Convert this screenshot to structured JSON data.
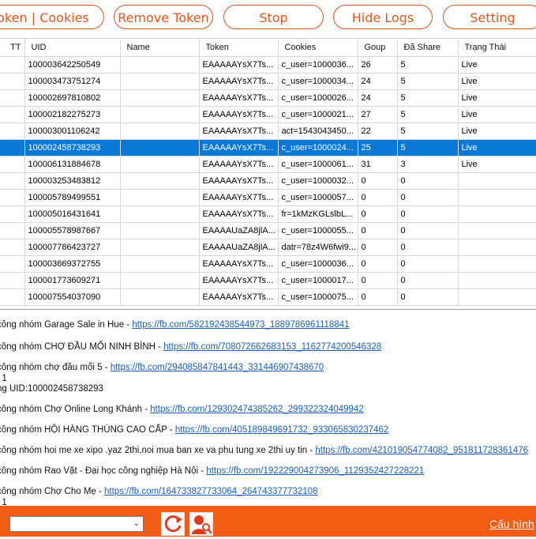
{
  "toolbar": {
    "token_cookies_label": "Token | Cookies",
    "remove_token_label": "Remove Token",
    "stop_label": "Stop",
    "hide_logs_label": "Hide Logs",
    "setting_label": "Setting"
  },
  "grid": {
    "columns": [
      "TT",
      "UID",
      "Name",
      "Token",
      "Cookies",
      "Goup",
      "Đã Share",
      "Trạng Thái"
    ],
    "selected_row": 5,
    "rows": [
      {
        "uid": "100003642250549",
        "name": "",
        "token": "EAAAAAYsX7Ts...",
        "cookies": "c_user=1000036...",
        "goup": "26",
        "shared": "5",
        "status": "Live"
      },
      {
        "uid": "100003473751274",
        "name": "",
        "token": "EAAAAAYsX7Ts...",
        "cookies": "c_user=1000034...",
        "goup": "24",
        "shared": "5",
        "status": "Live"
      },
      {
        "uid": "100002697810802",
        "name": "",
        "token": "EAAAAAYsX7Ts...",
        "cookies": "c_user=1000026...",
        "goup": "24",
        "shared": "5",
        "status": "Live"
      },
      {
        "uid": "100002182275273",
        "name": "",
        "token": "EAAAAAYsX7Ts...",
        "cookies": "c_user=1000021...",
        "goup": "27",
        "shared": "5",
        "status": "Live"
      },
      {
        "uid": "100003001106242",
        "name": "",
        "token": "EAAAAAYsX7Ts...",
        "cookies": "act=1543043450...",
        "goup": "22",
        "shared": "5",
        "status": "Live"
      },
      {
        "uid": "100002458738293",
        "name": "",
        "token": "EAAAAAYsX7Ts...",
        "cookies": "c_user=1000024...",
        "goup": "25",
        "shared": "5",
        "status": "Live"
      },
      {
        "uid": "100006131884678",
        "name": "",
        "token": "EAAAAAYsX7Ts...",
        "cookies": "c_user=1000061...",
        "goup": "31",
        "shared": "3",
        "status": "Live"
      },
      {
        "uid": "100003253483812",
        "name": "",
        "token": "EAAAAAYsX7Ts...",
        "cookies": "c_user=1000032...",
        "goup": "0",
        "shared": "0",
        "status": ""
      },
      {
        "uid": "100005789499551",
        "name": "",
        "token": "EAAAAAYsX7Ts...",
        "cookies": "c_user=1000057...",
        "goup": "0",
        "shared": "0",
        "status": ""
      },
      {
        "uid": "100005016431641",
        "name": "",
        "token": "EAAAAAYsX7Ts...",
        "cookies": "fr=1kMzKGLslbL...",
        "goup": "0",
        "shared": "0",
        "status": ""
      },
      {
        "uid": "100005578987667",
        "name": "",
        "token": "EAAAAUaZA8jlA...",
        "cookies": "c_user=1000055...",
        "goup": "0",
        "shared": "0",
        "status": ""
      },
      {
        "uid": "100007786423727",
        "name": "",
        "token": "EAAAAUaZA8jlA...",
        "cookies": "datr=78z4W6fwi9...",
        "goup": "0",
        "shared": "0",
        "status": ""
      },
      {
        "uid": "100003669372755",
        "name": "",
        "token": "EAAAAAYsX7Ts...",
        "cookies": "c_user=1000036...",
        "goup": "0",
        "shared": "0",
        "status": ""
      },
      {
        "uid": "100001773609271",
        "name": "",
        "token": "EAAAAAYsX7Ts...",
        "cookies": "c_user=1000017...",
        "goup": "0",
        "shared": "0",
        "status": ""
      },
      {
        "uid": "100007554037090",
        "name": "",
        "token": "EAAAAAYsX7Ts...",
        "cookies": "c_user=1000075...",
        "goup": "0",
        "shared": "0",
        "status": ""
      }
    ]
  },
  "logs": [
    {
      "text": "công nhóm Garage Sale in Hue - ",
      "link": "https://fb.com/582192438544973_1889786961118841"
    },
    {
      "text": "công nhóm CHỢ ĐẦU MỐI NINH BÌNH - ",
      "link": "https://fb.com/708072662683153_1162774200546328"
    },
    {
      "text": "công nhóm chợ đầu mối 5 - ",
      "link": "https://fb.com/294085847841443_331446907438670"
    },
    {
      "text": ": 1",
      "link": ""
    },
    {
      "text": "ng UID:100002458738293",
      "link": ""
    },
    {
      "text": "công nhóm Chợ Online Long Khánh - ",
      "link": "https://fb.com/129302474385262_299322324049942"
    },
    {
      "text": "công nhóm HỘI HÀNG THÙNG CAO CẤP - ",
      "link": "https://fb.com/405189849691732_933065830237462"
    },
    {
      "text": "công nhóm hoi me xe xipo .yaz 2thi,noi mua ban xe va phu tung xe 2thi uy tin - ",
      "link": "https://fb.com/421019054774082_951811728361476"
    },
    {
      "text": "công nhóm Rao Vặt - Đại học công nghiệp Hà Nội - ",
      "link": "https://fb.com/192229004273906_1129352427228221"
    },
    {
      "text": "công nhóm Chợ Cho Mẹ - ",
      "link": "https://fb.com/164733827733064_264743377732108"
    },
    {
      "text": ": 1",
      "link": ""
    }
  ],
  "bottom": {
    "select_value": "",
    "config_link": "Cấu hình"
  },
  "colors": {
    "accent": "#f25c14",
    "selection": "#0a78d7",
    "link": "#1a5fb4"
  }
}
